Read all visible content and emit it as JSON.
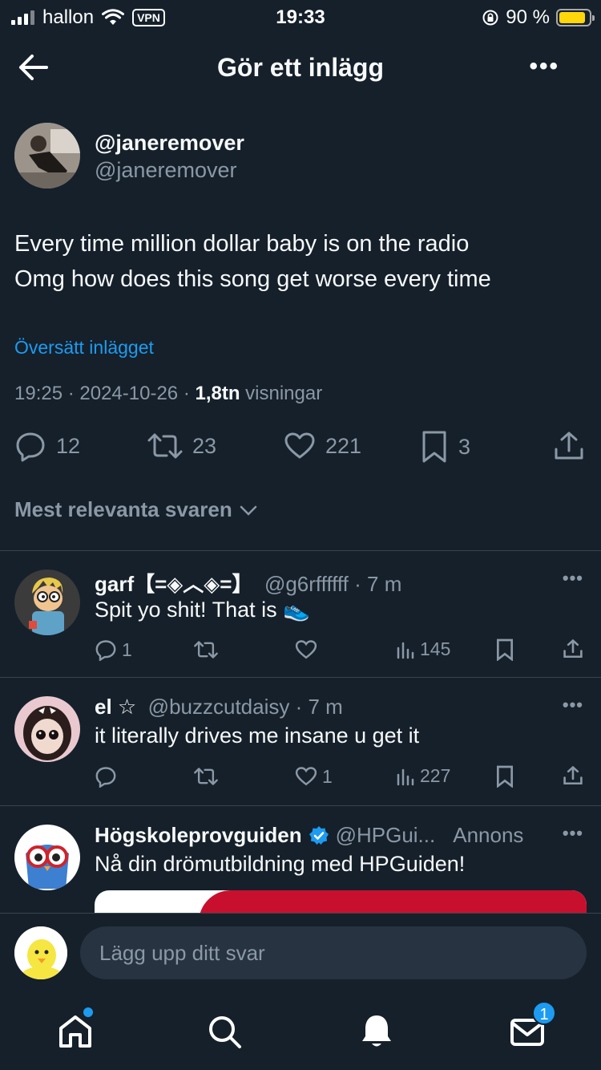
{
  "status_bar": {
    "carrier": "hallon",
    "vpn": "VPN",
    "time": "19:33",
    "battery": "90 %",
    "battery_color": "#ffd60a"
  },
  "header": {
    "title": "Gör ett inlägg",
    "more": "•••"
  },
  "tweet": {
    "display_name": "@janeremover",
    "handle": "@janeremover",
    "text_line1": "Every time million dollar baby is on the radio",
    "text_line2": "Omg how does this song get worse every time",
    "translate": "Översätt inlägget",
    "timestamp": "19:25 · 2024-10-26 · ",
    "views_count": "1,8tn",
    "views_label": " visningar",
    "replies": "12",
    "reposts": "23",
    "likes": "221",
    "bookmarks": "3"
  },
  "sort_label": "Mest relevanta svaren",
  "replies": [
    {
      "name": "garf【=◈︿◈=】",
      "handle": "@g6rffffff",
      "time": "· 7 m",
      "text": "Spit yo shit! That is 👟",
      "replies": "1",
      "reposts": "",
      "likes": "",
      "views": "145"
    },
    {
      "name": "el ☆",
      "handle": "@buzzcutdaisy",
      "time": "· 7 m",
      "text": "it literally drives me insane u get it",
      "replies": "",
      "reposts": "",
      "likes": "1",
      "views": "227"
    }
  ],
  "ad": {
    "name": "Högskoleprovguiden",
    "handle": "@HPGui...",
    "label": "Annons",
    "text": "Nå din drömutbildning med HPGuiden!"
  },
  "reply_input": {
    "placeholder": "Lägg upp ditt svar"
  },
  "tabbar": {
    "messages_badge": "1",
    "accent": "#1d9bf0"
  },
  "icons": [
    "back-arrow-icon",
    "more-icon",
    "reply-icon",
    "repost-icon",
    "like-icon",
    "bookmark-icon",
    "share-icon",
    "views-icon",
    "verified-icon",
    "home-icon",
    "search-icon",
    "bell-icon",
    "mail-icon"
  ]
}
